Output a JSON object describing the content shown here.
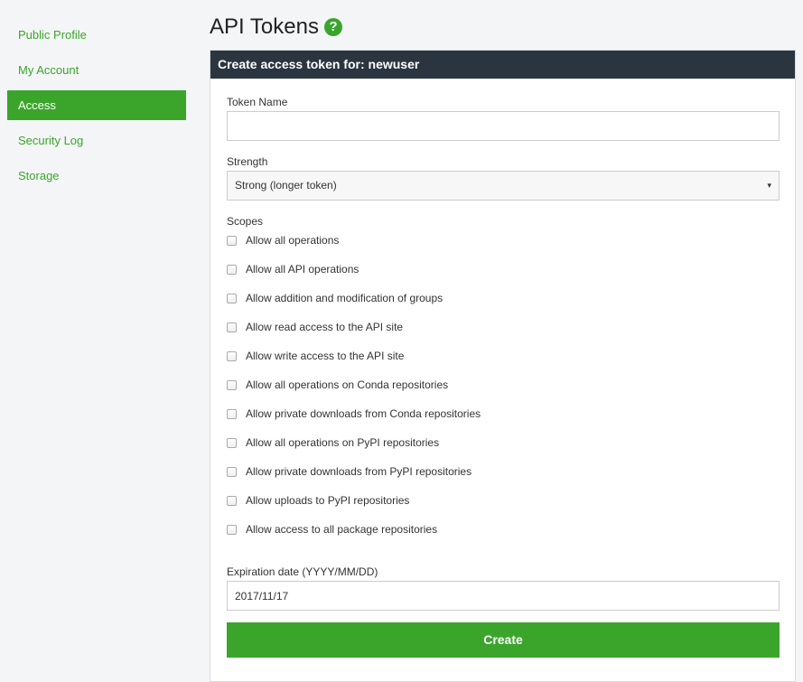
{
  "sidebar": {
    "items": [
      {
        "label": "Public Profile"
      },
      {
        "label": "My Account"
      },
      {
        "label": "Access",
        "active": true
      },
      {
        "label": "Security Log"
      },
      {
        "label": "Storage"
      }
    ]
  },
  "page": {
    "title": "API Tokens",
    "help_icon": "?"
  },
  "panel": {
    "header": "Create access token for: newuser"
  },
  "form": {
    "token_name": {
      "label": "Token Name",
      "value": "",
      "placeholder": ""
    },
    "strength": {
      "label": "Strength",
      "selected": "Strong (longer token)",
      "arrow": "▾"
    },
    "scopes": {
      "label": "Scopes",
      "items": [
        "Allow all operations",
        "Allow all API operations",
        "Allow addition and modification of groups",
        "Allow read access to the API site",
        "Allow write access to the API site",
        "Allow all operations on Conda repositories",
        "Allow private downloads from Conda repositories",
        "Allow all operations on PyPI repositories",
        "Allow private downloads from PyPI repositories",
        "Allow uploads to PyPI repositories",
        "Allow access to all package repositories"
      ]
    },
    "expiration": {
      "label": "Expiration date (YYYY/MM/DD)",
      "value": "2017/11/17"
    },
    "create_label": "Create"
  },
  "colors": {
    "accent": "#3aa52a",
    "header_bg": "#2a3540"
  }
}
